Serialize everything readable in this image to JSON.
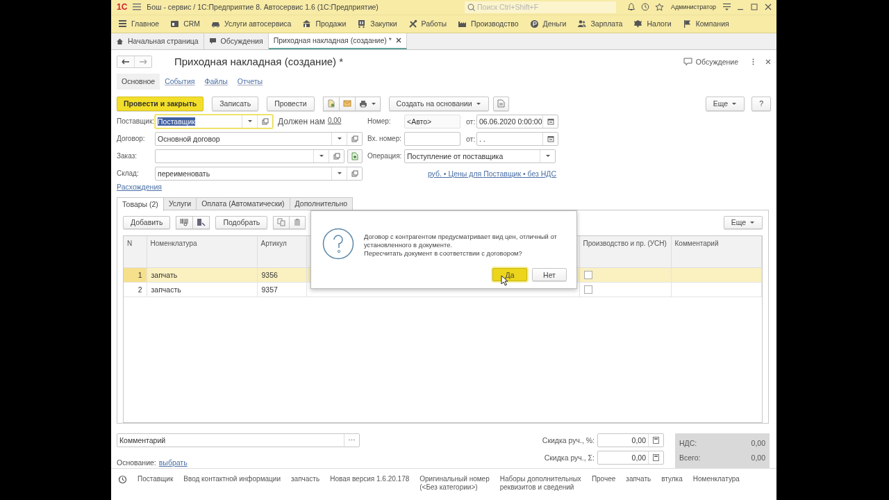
{
  "window": {
    "logo": "1С",
    "title": "Бош - сервис / 1С:Предприятие 8. Автосервис 1.6  (1С:Предприятие)",
    "search": {
      "placeholder": "Поиск Ctrl+Shift+F"
    },
    "user": "Администратор"
  },
  "sections": [
    {
      "label": "Главное"
    },
    {
      "label": "CRM"
    },
    {
      "label": "Услуги автосервиса"
    },
    {
      "label": "Продажи"
    },
    {
      "label": "Закупки"
    },
    {
      "label": "Работы"
    },
    {
      "label": "Производство"
    },
    {
      "label": "Деньги"
    },
    {
      "label": "Зарплата"
    },
    {
      "label": "Налоги"
    },
    {
      "label": "Компания"
    }
  ],
  "open_tabs": [
    {
      "label": "Начальная страница",
      "selected": false
    },
    {
      "label": "Обсуждения",
      "selected": false
    },
    {
      "label": "Приходная накладная (создание) *",
      "selected": true
    }
  ],
  "form": {
    "title": "Приходная накладная (создание) *",
    "discussion": "Обсуждение",
    "nav": [
      {
        "label": "Основное",
        "selected": true
      },
      {
        "label": "События",
        "selected": false
      },
      {
        "label": "Файлы",
        "selected": false
      },
      {
        "label": "Отчеты",
        "selected": false
      }
    ],
    "buttons": [
      {
        "label": "Провести и закрыть",
        "kind": "primary"
      },
      {
        "label": "Записать",
        "kind": "plain"
      },
      {
        "label": "Провести",
        "kind": "plain"
      }
    ],
    "create_based_on": "Создать на основании",
    "more": "Еще",
    "help": "?",
    "supplier": {
      "label": "Поставщик:",
      "value": "Поставщик",
      "focused": true
    },
    "owes": {
      "label": "Должен нам",
      "amount": "0,00"
    },
    "contract": {
      "label": "Договор:",
      "value": "Основной договор"
    },
    "order": {
      "label": "Заказ:"
    },
    "warehouse": {
      "label": "Склад:",
      "value": "переименовать"
    },
    "number": {
      "label": "Номер:",
      "placeholder": "<Авто>"
    },
    "date": {
      "label": "от:",
      "value": "06.06.2020  0:00:00"
    },
    "in_number": {
      "label": "Вх. номер:"
    },
    "in_date": {
      "label": "от:",
      "value": " .  ."
    },
    "operation": {
      "label": "Операция:",
      "value": "Поступление от поставщика"
    },
    "prices_link": "руб. • Цены для Поставщик • без НДС",
    "discrepancies_link": "Расхождения",
    "tabs": [
      {
        "label": "Товары (2)",
        "selected": true
      },
      {
        "label": "Услуги",
        "selected": false
      },
      {
        "label": "Оплата (Автоматически)",
        "selected": false
      },
      {
        "label": "Дополнительно",
        "selected": false
      }
    ],
    "goods": {
      "add": "Добавить",
      "pick": "Подобрать",
      "more": "Еще",
      "columns": [
        "N",
        "Номенклатура",
        "Артикул",
        "Производство и пр. (УСН)",
        "Комментарий"
      ],
      "rows": [
        {
          "n": "1",
          "name": "запчать",
          "article": "9356",
          "production": false,
          "selected": true
        },
        {
          "n": "2",
          "name": "запчасть",
          "article": "9357",
          "production": false,
          "selected": false
        }
      ]
    },
    "comment": {
      "placeholder": "Комментарий"
    },
    "basis": {
      "label": "Основание:",
      "link": "выбрать"
    },
    "discounts": [
      {
        "label": "Скидка руч., %:",
        "value": "0,00"
      },
      {
        "label": "Скидка руч., Σ:",
        "value": "0,00"
      }
    ],
    "totals": [
      {
        "label": "НДС:",
        "value": "0,00"
      },
      {
        "label": "Всего:",
        "value": "0,00"
      }
    ]
  },
  "footer_links": [
    "Поставщик",
    "Ввод контактной информации",
    "запчасть",
    "Новая версия 1.6.20.178",
    "Оригинальный номер\n(<Без категории>)",
    "Наборы дополнительных\nреквизитов и сведений",
    "Прочее",
    "запчать",
    "втулка",
    "Номенклатура"
  ],
  "dialog": {
    "message": "Договор с контрагентом предусматривает вид цен, отличный от\nустановленного в документе.\nПересчитать документ в соответствии с договором?",
    "buttons": [
      {
        "label": "Да",
        "default": true
      },
      {
        "label": "Нет",
        "default": false
      }
    ]
  }
}
